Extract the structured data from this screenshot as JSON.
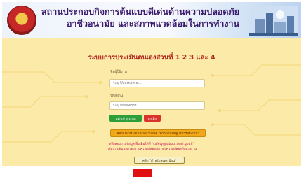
{
  "header": {
    "title_line1": "สถานประกอบกิจการต้นแบบดีเด่นด้านความปลอดภัย",
    "title_line2": "อาชีวอนามัย และสภาพแวดล้อมในการทำงาน",
    "seal_icon": "government-seal",
    "illustration_icon": "factory-illustration"
  },
  "form": {
    "title": "ระบบการประเมินตนเองส่วนที่ 1 2 3 และ 4",
    "username_label": "ชื่อผู้ใช้งาน",
    "username_placeholder": "ระบุ Username...",
    "password_label": "รหัสผ่าน",
    "password_placeholder": "ระบุ Password...",
    "login_button": "หลักเข้าสู่ระบบ",
    "cancel_button": "ยกเลิก",
    "manual_button": "คลิกแนะประเมินระบบเว็บไซต์ \"ดาวน์โหลดคู่มือการประเมิน\"",
    "info_line1": "หรือสอบถามข้อมูลเพิ่มเติมได้ที่ \"safety@labour.mail.go.th\"",
    "info_line2": "กลุ่มงานพัฒนามาตรฐานความปลอดภัย กองความปลอดภัยแรงงาน",
    "register_button": "คลิก \"สำหรับลงทะเบียน\""
  },
  "colors": {
    "page_bg": "#fbeaa8",
    "title": "#b3261e",
    "login": "#2e9e3a",
    "cancel": "#d9342b",
    "manual": "#f0a818",
    "info": "#c2185b",
    "bottom_red": "#e01010"
  }
}
